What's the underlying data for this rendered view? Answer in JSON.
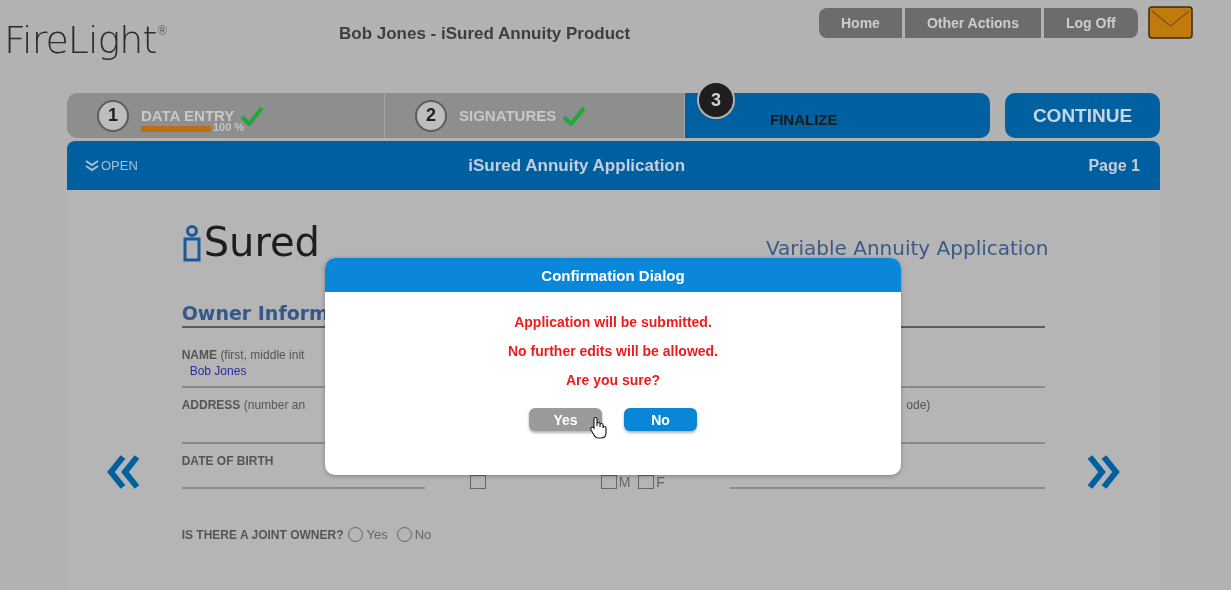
{
  "header": {
    "logo": "FireLight",
    "logo_mark": "®",
    "title": "Bob Jones - iSured Annuity Product",
    "nav": [
      "Home",
      "Other Actions",
      "Log Off"
    ]
  },
  "steps": [
    {
      "number": "1",
      "label": "DATA ENTRY",
      "done": true,
      "selected": false,
      "progress": {
        "reading": "100 %"
      }
    },
    {
      "number": "2",
      "label": "SIGNATURES",
      "done": true,
      "selected": false
    },
    {
      "number": "3",
      "label": "FINALIZE",
      "done": false,
      "selected": true
    }
  ],
  "continue_button": "CONTINUE",
  "form_bar": {
    "toggle": "OPEN",
    "title": "iSured Annuity Application",
    "page": "Page 1"
  },
  "form": {
    "logo": "Sured",
    "subtitle": "Variable Annuity Application",
    "section": "Owner Inform",
    "name_field": {
      "label": "NAME",
      "note": "(first, middle init",
      "value": "Bob Jones"
    },
    "address_field": {
      "label": "ADDRESS",
      "note": "(number an",
      "note_2": "ode)"
    },
    "birth_field": {
      "label": "DATE OF BIRTH"
    },
    "checkboxes": [
      {
        "checked": false
      },
      {
        "label": "M",
        "checked": false
      },
      {
        "label": "F",
        "checked": false
      }
    ],
    "joint_owner": {
      "question": "IS THERE A JOINT OWNER?",
      "options": [
        {
          "label": "Yes",
          "selected": false
        },
        {
          "label": "No",
          "selected": false
        }
      ]
    }
  },
  "dialog": {
    "title": "Confirmation Dialog",
    "lines": [
      "Application will be submitted.",
      "No further edits will be allowed.",
      "Are you sure?"
    ],
    "buttons": [
      {
        "label": "Yes",
        "kind": "muted",
        "hovered": true
      },
      {
        "label": "No",
        "kind": "primary",
        "hovered": false
      }
    ]
  }
}
